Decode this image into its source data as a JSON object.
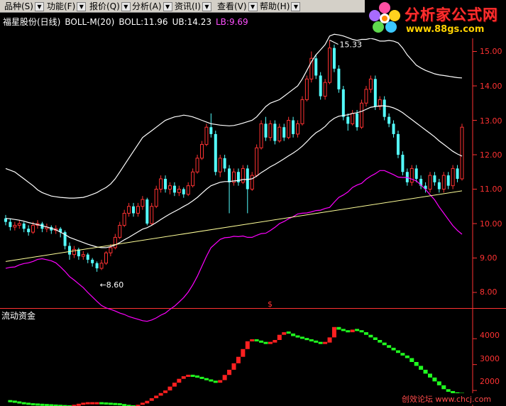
{
  "menu": [
    {
      "label": "品种(S)"
    },
    {
      "label": "功能(F)"
    },
    {
      "label": "报价(Q)"
    },
    {
      "label": "分析(A)"
    },
    {
      "label": "资讯(I)"
    },
    {
      "label": "查看(V)"
    },
    {
      "label": "帮助(H)"
    }
  ],
  "logo": {
    "title": "分析家公式网",
    "url": "www.88gs.com"
  },
  "legend": {
    "stock": "福星股份(日线)",
    "indicator": "BOLL-M(20)",
    "boll": "BOLL:11.96",
    "ub": "UB:14.23",
    "lb": "LB:9.69"
  },
  "colors": {
    "up": "#ff3232",
    "down": "#54ffff",
    "mid": "#ffffff",
    "upper": "#ffffff",
    "lower": "#ff00ff",
    "trend": "#ffff99",
    "axis": "#ff3232",
    "flow_up": "#ff2020",
    "flow_down": "#20ff20"
  },
  "price_axis": {
    "labels": [
      "15.00",
      "14.00",
      "13.00",
      "12.00",
      "11.00",
      "10.00",
      "9.00",
      "8.00"
    ],
    "min": 8.0,
    "max": 15.0
  },
  "annotations": {
    "high": "15.33",
    "low": "8.60",
    "mark": "$"
  },
  "flow_panel": {
    "title": "流动资金",
    "labels": [
      "4000",
      "3000",
      "2000"
    ]
  },
  "watermark": "创效论坛 www.chcj.com",
  "chart_data": {
    "type": "candlestick",
    "candles": [
      [
        10.15,
        10.05,
        10.25,
        9.95
      ],
      [
        10.05,
        9.9,
        10.15,
        9.8
      ],
      [
        9.9,
        9.95,
        10.05,
        9.8
      ],
      [
        9.95,
        10.0,
        10.1,
        9.85
      ],
      [
        10.0,
        9.85,
        10.05,
        9.75
      ],
      [
        9.85,
        9.75,
        9.95,
        9.65
      ],
      [
        9.75,
        9.95,
        10.05,
        9.7
      ],
      [
        9.95,
        10.0,
        10.1,
        9.85
      ],
      [
        10.0,
        9.85,
        10.05,
        9.75
      ],
      [
        9.85,
        9.9,
        10.0,
        9.75
      ],
      [
        9.9,
        9.8,
        9.95,
        9.7
      ],
      [
        9.8,
        9.85,
        9.95,
        9.7
      ],
      [
        9.85,
        9.75,
        9.9,
        9.6
      ],
      [
        9.75,
        9.35,
        9.8,
        9.25
      ],
      [
        9.35,
        9.1,
        9.45,
        8.95
      ],
      [
        9.1,
        9.25,
        9.35,
        9.0
      ],
      [
        9.25,
        9.05,
        9.3,
        8.95
      ],
      [
        9.05,
        9.1,
        9.2,
        8.95
      ],
      [
        9.1,
        8.95,
        9.15,
        8.85
      ],
      [
        8.95,
        8.85,
        9.0,
        8.75
      ],
      [
        8.85,
        8.7,
        8.9,
        8.6
      ],
      [
        8.7,
        8.85,
        8.95,
        8.65
      ],
      [
        8.85,
        9.15,
        9.2,
        8.8
      ],
      [
        9.15,
        9.3,
        9.4,
        9.05
      ],
      [
        9.3,
        9.6,
        9.7,
        9.25
      ],
      [
        9.6,
        9.95,
        10.05,
        9.55
      ],
      [
        9.95,
        10.3,
        10.4,
        9.9
      ],
      [
        10.3,
        10.5,
        10.6,
        10.2
      ],
      [
        10.5,
        10.3,
        10.6,
        10.2
      ],
      [
        10.3,
        10.5,
        10.6,
        10.2
      ],
      [
        10.5,
        10.7,
        10.8,
        10.4
      ],
      [
        10.7,
        10.0,
        10.75,
        9.95
      ],
      [
        10.0,
        10.5,
        10.6,
        9.95
      ],
      [
        10.5,
        11.0,
        11.1,
        10.45
      ],
      [
        11.0,
        11.3,
        11.4,
        10.9
      ],
      [
        11.3,
        11.0,
        11.4,
        10.9
      ],
      [
        11.0,
        11.1,
        11.2,
        10.85
      ],
      [
        11.1,
        10.9,
        11.2,
        10.8
      ],
      [
        10.9,
        11.0,
        11.1,
        10.8
      ],
      [
        11.0,
        10.85,
        11.05,
        10.75
      ],
      [
        10.85,
        11.1,
        11.2,
        10.8
      ],
      [
        11.1,
        11.5,
        11.6,
        11.05
      ],
      [
        11.5,
        11.9,
        12.0,
        11.45
      ],
      [
        11.9,
        12.3,
        12.4,
        11.85
      ],
      [
        12.3,
        12.8,
        12.9,
        12.25
      ],
      [
        12.8,
        12.6,
        13.2,
        12.5
      ],
      [
        12.6,
        11.5,
        12.7,
        11.4
      ],
      [
        11.5,
        11.9,
        12.0,
        11.35
      ],
      [
        11.9,
        11.6,
        12.0,
        11.5
      ],
      [
        11.6,
        11.2,
        11.7,
        10.3
      ],
      [
        11.2,
        11.5,
        11.6,
        11.1
      ],
      [
        11.5,
        11.2,
        11.6,
        11.1
      ],
      [
        11.2,
        11.6,
        11.7,
        11.15
      ],
      [
        11.6,
        11.0,
        11.7,
        10.3
      ],
      [
        11.0,
        11.4,
        11.5,
        10.95
      ],
      [
        11.4,
        12.2,
        12.3,
        11.35
      ],
      [
        12.2,
        12.9,
        13.0,
        12.15
      ],
      [
        12.9,
        12.5,
        13.1,
        12.4
      ],
      [
        12.5,
        12.9,
        13.0,
        12.4
      ],
      [
        12.9,
        12.4,
        13.0,
        12.3
      ],
      [
        12.4,
        12.8,
        12.9,
        12.35
      ],
      [
        12.8,
        12.5,
        12.9,
        12.4
      ],
      [
        12.5,
        13.0,
        13.1,
        12.45
      ],
      [
        13.0,
        12.6,
        13.1,
        12.5
      ],
      [
        12.6,
        12.9,
        13.0,
        12.5
      ],
      [
        12.9,
        13.6,
        13.7,
        12.85
      ],
      [
        13.6,
        14.2,
        14.3,
        13.55
      ],
      [
        14.2,
        14.8,
        15.0,
        14.1
      ],
      [
        14.8,
        14.3,
        14.9,
        14.2
      ],
      [
        14.3,
        13.7,
        14.4,
        13.6
      ],
      [
        13.7,
        14.1,
        14.2,
        13.6
      ],
      [
        14.1,
        15.1,
        15.33,
        14.05
      ],
      [
        15.1,
        14.5,
        15.2,
        14.4
      ],
      [
        14.5,
        13.9,
        14.6,
        13.8
      ],
      [
        13.9,
        13.1,
        14.0,
        13.0
      ],
      [
        13.1,
        12.9,
        13.2,
        12.7
      ],
      [
        12.9,
        13.2,
        13.3,
        12.85
      ],
      [
        13.2,
        12.8,
        13.3,
        12.7
      ],
      [
        12.8,
        13.5,
        13.6,
        12.75
      ],
      [
        13.5,
        13.9,
        14.0,
        13.4
      ],
      [
        13.9,
        14.2,
        14.3,
        13.8
      ],
      [
        14.2,
        13.4,
        14.3,
        13.3
      ],
      [
        13.4,
        13.6,
        13.7,
        13.3
      ],
      [
        13.6,
        13.1,
        13.7,
        13.0
      ],
      [
        13.1,
        12.9,
        13.2,
        12.8
      ],
      [
        12.9,
        12.6,
        13.0,
        12.5
      ],
      [
        12.6,
        12.0,
        12.7,
        11.9
      ],
      [
        12.0,
        11.5,
        12.1,
        11.4
      ],
      [
        11.5,
        11.2,
        11.6,
        11.1
      ],
      [
        11.2,
        11.6,
        11.7,
        11.1
      ],
      [
        11.6,
        11.3,
        11.7,
        11.2
      ],
      [
        11.3,
        11.1,
        11.4,
        11.0
      ],
      [
        11.1,
        11.0,
        11.2,
        10.9
      ],
      [
        11.0,
        11.4,
        11.5,
        10.9
      ],
      [
        11.4,
        11.2,
        11.5,
        11.1
      ],
      [
        11.2,
        11.0,
        11.3,
        10.9
      ],
      [
        11.0,
        11.4,
        11.5,
        10.9
      ],
      [
        11.4,
        11.1,
        11.5,
        11.0
      ],
      [
        11.1,
        11.6,
        11.7,
        11.0
      ],
      [
        11.6,
        11.3,
        11.7,
        11.2
      ],
      [
        11.3,
        12.8,
        12.9,
        11.25
      ]
    ],
    "boll_mid": [
      10.15,
      10.14,
      10.12,
      10.1,
      10.07,
      10.03,
      10.0,
      9.97,
      9.94,
      9.9,
      9.86,
      9.82,
      9.75,
      9.68,
      9.6,
      9.55,
      9.5,
      9.45,
      9.4,
      9.36,
      9.32,
      9.3,
      9.3,
      9.33,
      9.38,
      9.45,
      9.53,
      9.6,
      9.68,
      9.76,
      9.84,
      9.88,
      9.95,
      10.03,
      10.12,
      10.2,
      10.28,
      10.35,
      10.42,
      10.5,
      10.57,
      10.66,
      10.76,
      10.88,
      11.0,
      11.1,
      11.15,
      11.2,
      11.22,
      11.22,
      11.24,
      11.25,
      11.28,
      11.28,
      11.3,
      11.38,
      11.48,
      11.56,
      11.65,
      11.72,
      11.8,
      11.88,
      11.97,
      12.05,
      12.14,
      12.25,
      12.38,
      12.52,
      12.64,
      12.72,
      12.82,
      12.96,
      13.06,
      13.12,
      13.14,
      13.16,
      13.2,
      13.22,
      13.26,
      13.32,
      13.38,
      13.4,
      13.42,
      13.42,
      13.4,
      13.36,
      13.3,
      13.22,
      13.12,
      13.02,
      12.92,
      12.82,
      12.72,
      12.62,
      12.52,
      12.4,
      12.3,
      12.2,
      12.1,
      12.02,
      11.96
    ],
    "boll_ub": [
      11.6,
      11.55,
      11.5,
      11.4,
      11.3,
      11.2,
      11.1,
      10.98,
      10.9,
      10.85,
      10.8,
      10.78,
      10.76,
      10.75,
      10.74,
      10.74,
      10.75,
      10.76,
      10.8,
      10.85,
      10.9,
      10.98,
      11.05,
      11.15,
      11.3,
      11.5,
      11.7,
      11.9,
      12.1,
      12.3,
      12.5,
      12.6,
      12.7,
      12.8,
      12.9,
      13.0,
      13.05,
      13.1,
      13.12,
      13.15,
      13.13,
      13.1,
      13.05,
      13.0,
      12.95,
      12.9,
      12.88,
      12.86,
      12.85,
      12.84,
      12.85,
      12.88,
      12.92,
      12.96,
      13.0,
      13.1,
      13.25,
      13.4,
      13.5,
      13.55,
      13.6,
      13.7,
      13.8,
      13.9,
      14.0,
      14.2,
      14.45,
      14.7,
      14.9,
      15.05,
      15.2,
      15.45,
      15.5,
      15.48,
      15.45,
      15.4,
      15.35,
      15.32,
      15.35,
      15.35,
      15.38,
      15.35,
      15.3,
      15.3,
      15.32,
      15.3,
      15.25,
      15.1,
      14.9,
      14.75,
      14.6,
      14.52,
      14.45,
      14.4,
      14.35,
      14.32,
      14.3,
      14.28,
      14.26,
      14.24,
      14.23
    ],
    "boll_lb": [
      8.7,
      8.73,
      8.74,
      8.8,
      8.84,
      8.86,
      8.9,
      8.96,
      8.98,
      8.95,
      8.92,
      8.86,
      8.74,
      8.61,
      8.46,
      8.36,
      8.25,
      8.14,
      8.0,
      7.87,
      7.74,
      7.62,
      7.55,
      7.51,
      7.46,
      7.4,
      7.36,
      7.3,
      7.26,
      7.22,
      7.18,
      7.16,
      7.2,
      7.26,
      7.34,
      7.4,
      7.51,
      7.6,
      7.72,
      7.85,
      8.01,
      8.22,
      8.47,
      8.76,
      9.05,
      9.3,
      9.42,
      9.54,
      9.59,
      9.6,
      9.63,
      9.62,
      9.64,
      9.6,
      9.6,
      9.66,
      9.71,
      9.72,
      9.8,
      9.89,
      10.0,
      10.06,
      10.14,
      10.2,
      10.28,
      10.3,
      10.31,
      10.34,
      10.38,
      10.39,
      10.44,
      10.47,
      10.62,
      10.76,
      10.83,
      10.92,
      11.05,
      11.12,
      11.17,
      11.29,
      11.38,
      11.45,
      11.54,
      11.54,
      11.48,
      11.42,
      11.35,
      11.34,
      11.34,
      11.29,
      11.24,
      11.12,
      10.99,
      10.84,
      10.69,
      10.48,
      10.3,
      10.12,
      9.94,
      9.8,
      9.69
    ],
    "trend_line": {
      "from": [
        0,
        8.9
      ],
      "to": [
        100,
        10.95
      ]
    },
    "flow": [
      1600,
      1580,
      1550,
      1520,
      1500,
      1480,
      1470,
      1460,
      1450,
      1440,
      1430,
      1420,
      1410,
      1400,
      1390,
      1420,
      1460,
      1500,
      1520,
      1520,
      1520,
      1510,
      1500,
      1490,
      1480,
      1450,
      1420,
      1400,
      1380,
      1420,
      1500,
      1600,
      1700,
      1800,
      1900,
      2000,
      2150,
      2300,
      2450,
      2550,
      2580,
      2550,
      2500,
      2450,
      2400,
      2350,
      2300,
      2400,
      2600,
      2800,
      3050,
      3300,
      3600,
      3900,
      3950,
      3900,
      3850,
      3800,
      3850,
      3950,
      4150,
      4250,
      4200,
      4100,
      4050,
      4000,
      3950,
      3900,
      3850,
      3800,
      3850,
      4050,
      4450,
      4350,
      4300,
      4250,
      4350,
      4300,
      4250,
      4150,
      4050,
      3950,
      3850,
      3750,
      3650,
      3550,
      3450,
      3350,
      3250,
      3100,
      2950,
      2800,
      2650,
      2500,
      2350,
      2200,
      2050,
      1950,
      1900,
      1880,
      1850
    ],
    "flow_range": [
      1400,
      4800
    ]
  }
}
